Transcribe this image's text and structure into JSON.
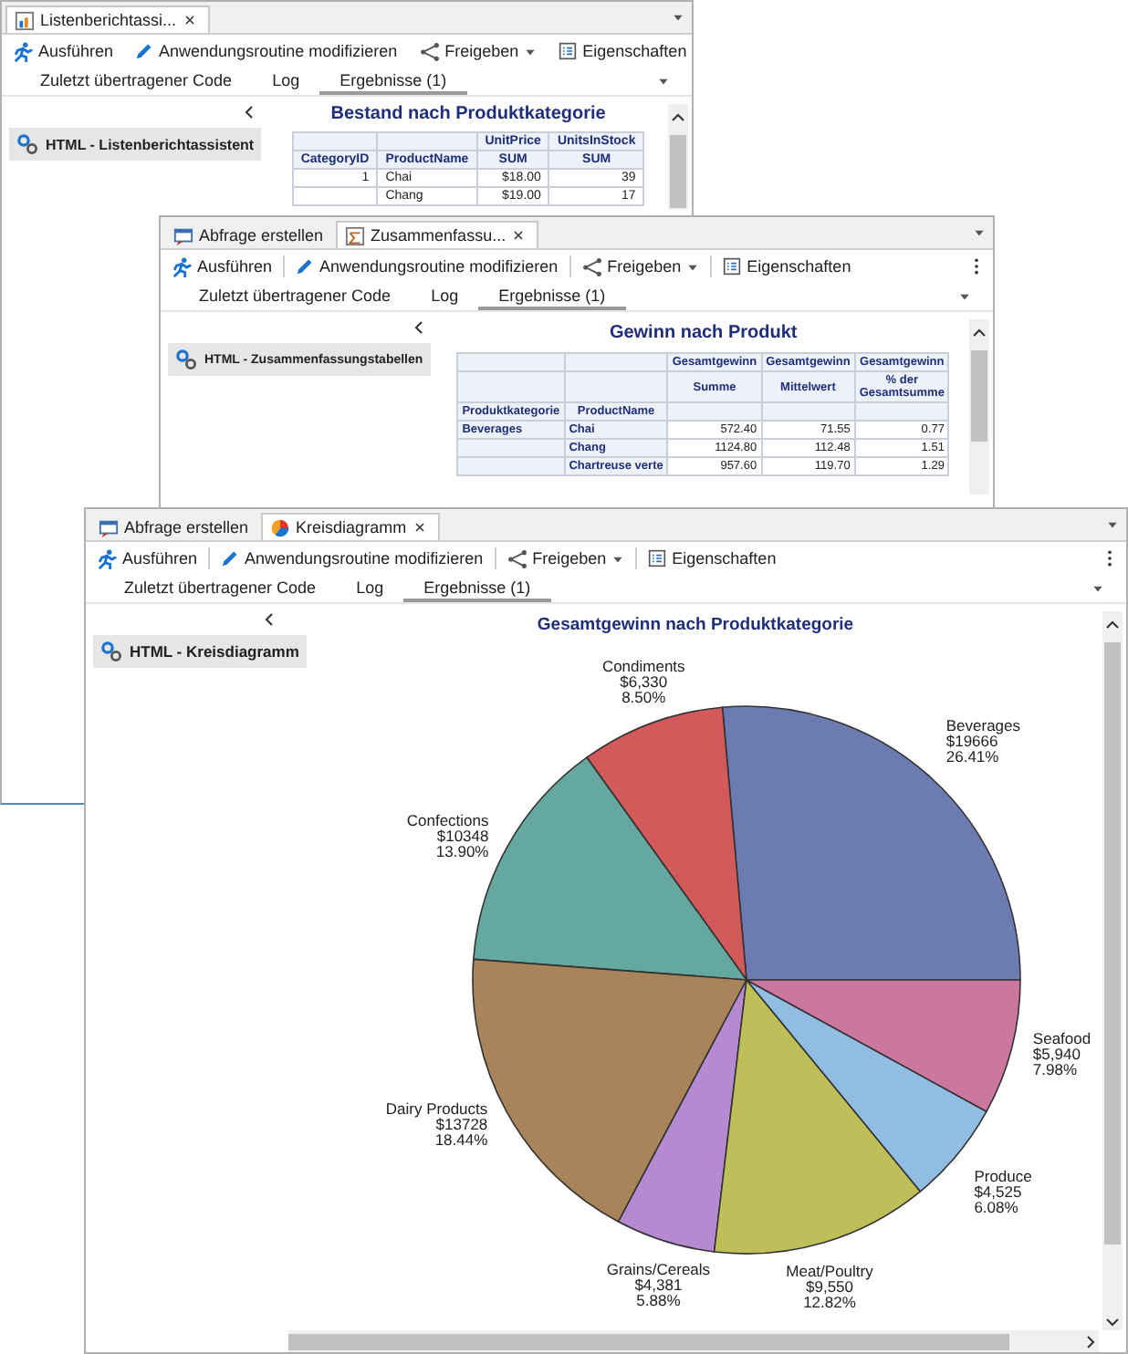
{
  "windows": [
    {
      "kind": "list_report",
      "tabs": [
        {
          "kind": "task",
          "label": "Listenberichtassi...",
          "selected": true
        }
      ],
      "toolbar": [
        {
          "kind": "button",
          "label": "Ausführen"
        },
        {
          "kind": "button",
          "label": "Anwendungsroutine modifizieren"
        },
        {
          "kind": "menu",
          "label": "Freigeben"
        },
        {
          "kind": "button",
          "label": "Eigenschaften"
        }
      ],
      "subtabs": [
        {
          "label": "Zuletzt übertragener Code",
          "selected": false
        },
        {
          "label": "Log",
          "selected": false
        },
        {
          "label": "Ergebnisse (1)",
          "selected": true
        }
      ],
      "sidebar_item": "HTML - Listenberichtassistent",
      "report": {
        "title": "Bestand nach Produktkategorie",
        "header_rows": [
          {
            "kind": "column_headers",
            "cells": [
              "UnitPrice",
              "UnitsInStock"
            ]
          },
          {
            "kind": "column_headers",
            "cells": [
              "CategoryID",
              "ProductName",
              "SUM",
              "SUM"
            ]
          }
        ],
        "rows": [
          {
            "group": "1",
            "cells": [
              "Chai",
              "$18.00",
              "39"
            ]
          },
          {
            "cells": [
              "Chang",
              "$19.00",
              "17"
            ]
          }
        ]
      }
    },
    {
      "kind": "summary_table",
      "tabs": [
        {
          "kind": "query",
          "label": "Abfrage erstellen",
          "selected": false
        },
        {
          "kind": "task",
          "label": "Zusammenfassu...",
          "selected": true
        }
      ],
      "toolbar": [
        {
          "kind": "button",
          "label": "Ausführen"
        },
        {
          "kind": "button",
          "label": "Anwendungsroutine modifizieren"
        },
        {
          "kind": "menu",
          "label": "Freigeben"
        },
        {
          "kind": "button",
          "label": "Eigenschaften"
        }
      ],
      "subtabs": [
        {
          "label": "Zuletzt übertragener Code",
          "selected": false
        },
        {
          "label": "Log",
          "selected": false
        },
        {
          "label": "Ergebnisse (1)",
          "selected": true
        }
      ],
      "sidebar_item": "HTML - Zusammenfassungstabellen",
      "report": {
        "title": "Gewinn nach Produkt",
        "header_rows": [
          {
            "kind": "column_headers",
            "cells": [
              "Gesamtgewinn",
              "Gesamtgewinn",
              "Gesamtgewinn"
            ]
          },
          {
            "kind": "column_headers",
            "cells": [
              "Summe",
              "Mittelwert",
              "% der Gesamtsumme"
            ]
          },
          {
            "kind": "row_headers",
            "cells": [
              "Produktkategorie",
              "ProductName"
            ]
          }
        ],
        "rows": [
          {
            "group": "Beverages",
            "cells": [
              "Chai",
              "572.40",
              "71.55",
              "0.77"
            ]
          },
          {
            "cells": [
              "Chang",
              "1124.80",
              "112.48",
              "1.51"
            ]
          },
          {
            "cells": [
              "Chartreuse verte",
              "957.60",
              "119.70",
              "1.29"
            ]
          }
        ]
      }
    },
    {
      "kind": "pie_chart",
      "tabs": [
        {
          "kind": "query",
          "label": "Abfrage erstellen",
          "selected": false
        },
        {
          "kind": "task",
          "label": "Kreisdiagramm",
          "selected": true
        }
      ],
      "toolbar": [
        {
          "kind": "button",
          "label": "Ausführen"
        },
        {
          "kind": "button",
          "label": "Anwendungsroutine modifizieren"
        },
        {
          "kind": "menu",
          "label": "Freigeben"
        },
        {
          "kind": "button",
          "label": "Eigenschaften"
        }
      ],
      "subtabs": [
        {
          "label": "Zuletzt übertragener Code",
          "selected": false
        },
        {
          "label": "Log",
          "selected": false
        },
        {
          "label": "Ergebnisse (1)",
          "selected": true
        }
      ],
      "sidebar_item": "HTML - Kreisdiagramm",
      "report": {
        "title": "Gesamtgewinn nach Produktkategorie",
        "chart_data": {
          "type": "pie",
          "categories": [
            "Beverages",
            "Condiments",
            "Confections",
            "Dairy Products",
            "Grains/Cereals",
            "Meat/Poultry",
            "Produce",
            "Seafood"
          ],
          "values": [
            26.41,
            8.5,
            13.9,
            18.44,
            5.88,
            12.82,
            6.08,
            7.98
          ]
        },
        "slices": [
          {
            "color": "#6c7bb0",
            "amount": "$19666",
            "percent": "26.41%"
          },
          {
            "color": "#d35a5a",
            "amount": "$6,330",
            "percent": "8.50%"
          },
          {
            "color": "#64a89f",
            "amount": "$10348",
            "percent": "13.90%"
          },
          {
            "color": "#a9845a",
            "amount": "$13728",
            "percent": "18.44%"
          },
          {
            "color": "#b58ad0",
            "amount": "$4,381",
            "percent": "5.88%"
          },
          {
            "color": "#bfbf5a",
            "amount": "$9,550",
            "percent": "12.82%"
          },
          {
            "color": "#92bde3",
            "amount": "$4,525",
            "percent": "6.08%"
          },
          {
            "color": "#cc77a0",
            "amount": "$5,940",
            "percent": "7.98%"
          }
        ]
      }
    }
  ]
}
